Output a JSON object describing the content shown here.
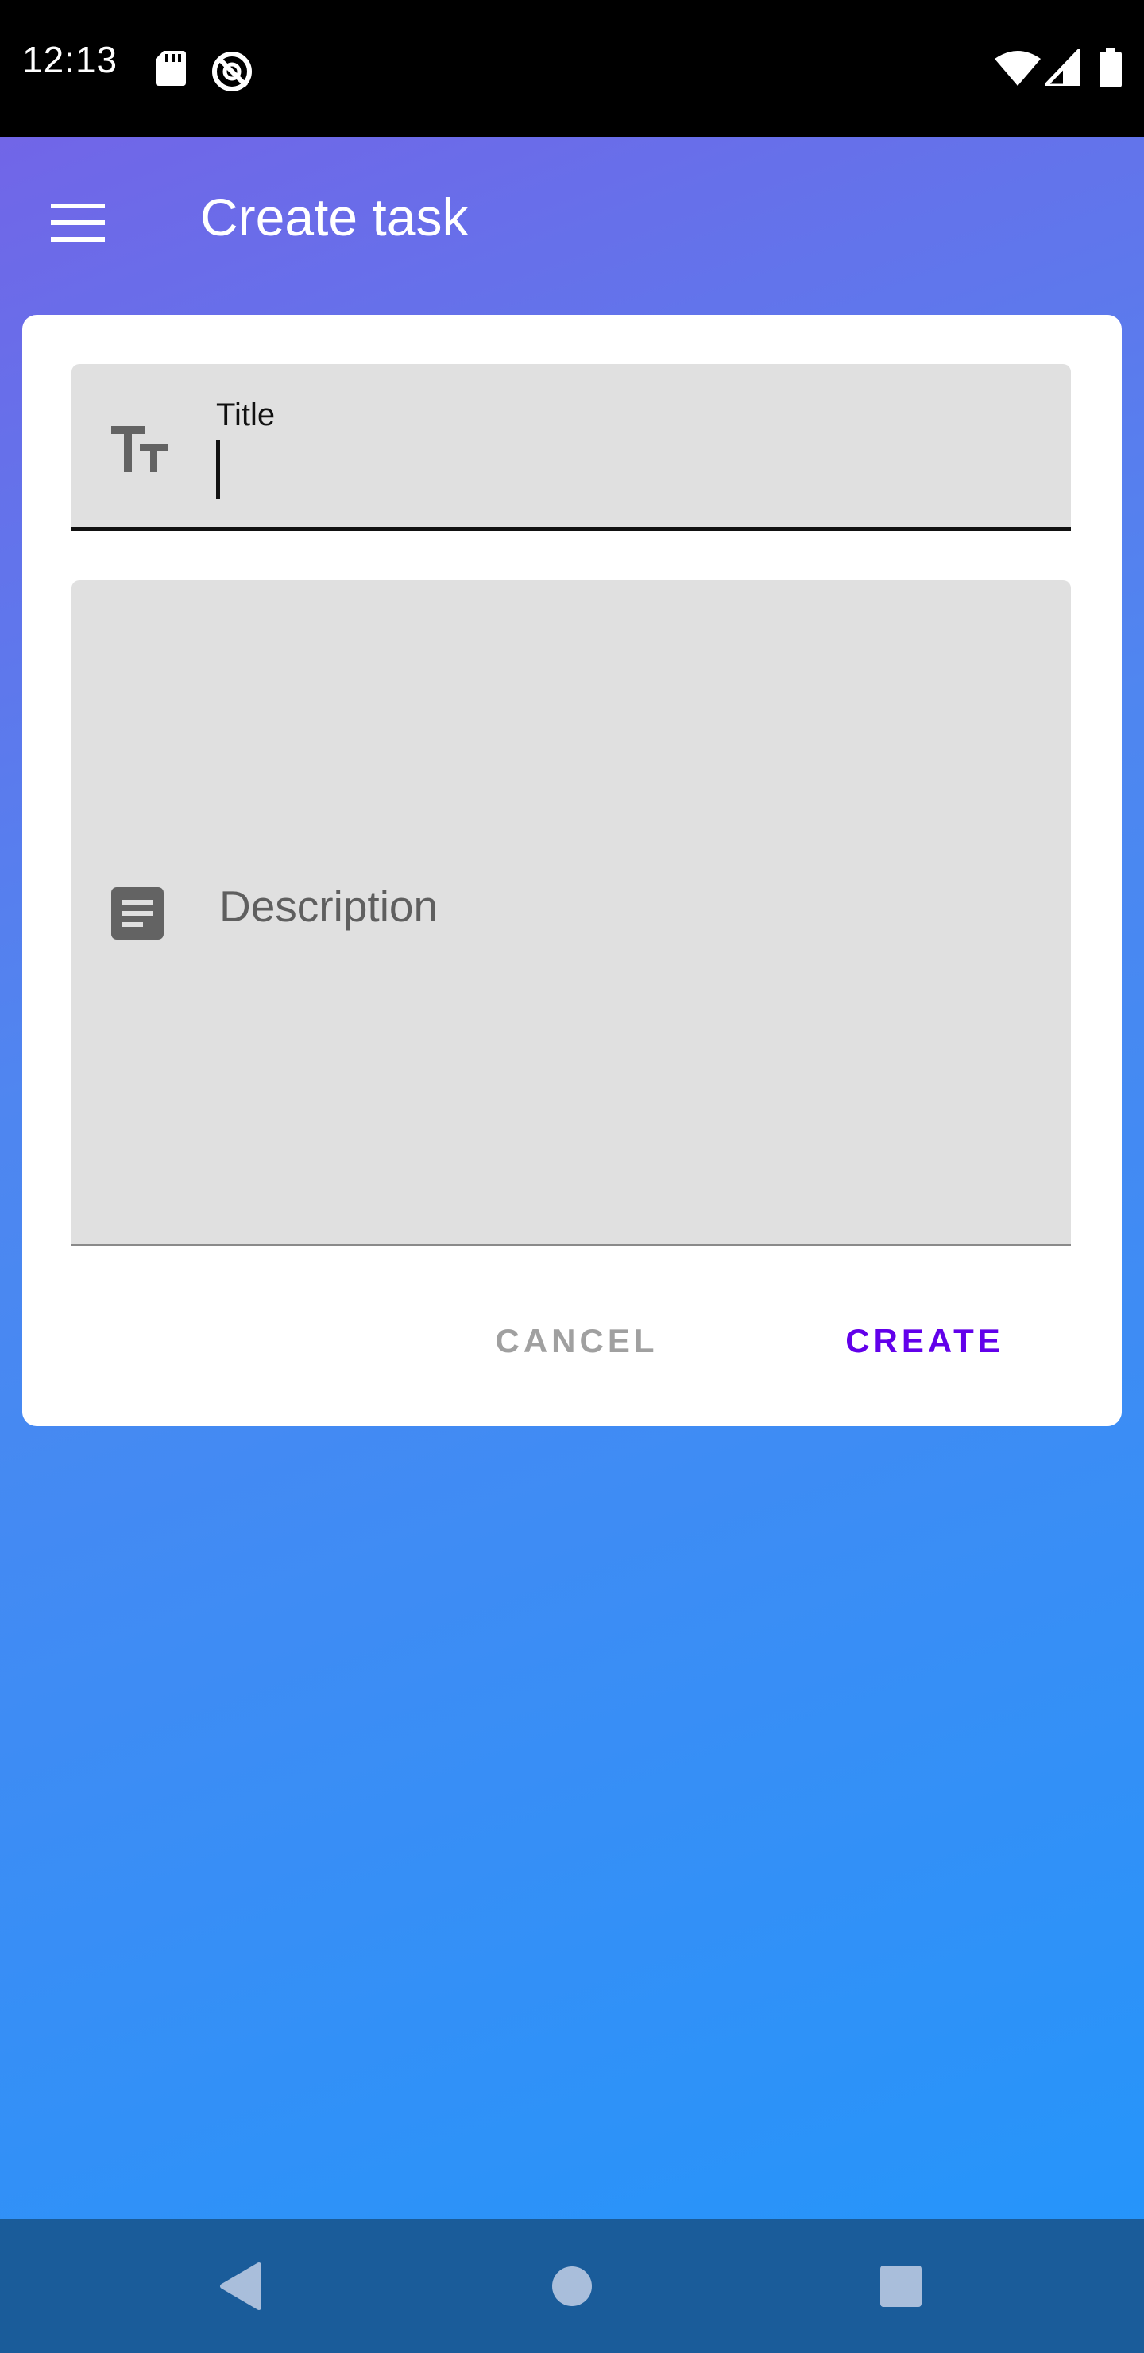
{
  "status_bar": {
    "time": "12:13",
    "left_icons": [
      "sd-card-icon",
      "privacy-indicator-icon"
    ],
    "right_icons": [
      "wifi-icon",
      "cellular-signal-icon",
      "battery-icon"
    ]
  },
  "app_bar": {
    "menu_icon": "menu-icon",
    "title": "Create task"
  },
  "form": {
    "title_field": {
      "icon": "text-size-icon",
      "label": "Title",
      "value": ""
    },
    "description_field": {
      "icon": "notes-icon",
      "placeholder": "Description",
      "value": ""
    },
    "cancel_label": "CANCEL",
    "create_label": "CREATE"
  },
  "nav_bar": {
    "back_icon": "back-triangle-icon",
    "home_icon": "home-circle-icon",
    "recents_icon": "recents-square-icon"
  },
  "colors": {
    "gradient_start": "#7661e6",
    "gradient_end": "#2296fb",
    "accent": "#6200ea",
    "field_background": "#e0e0e0",
    "nav_bar": "#1a5c9a"
  }
}
